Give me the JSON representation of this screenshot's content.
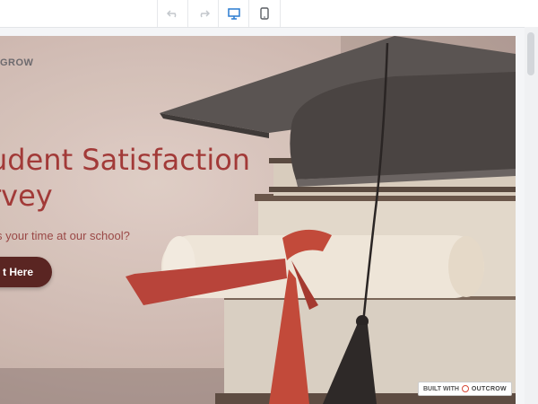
{
  "toolbar": {
    "undo_icon": "undo-icon",
    "redo_icon": "redo-icon",
    "desktop_icon": "desktop-icon",
    "mobile_icon": "mobile-icon",
    "active_color": "#2a7bd1"
  },
  "page": {
    "logo_text": "GROW",
    "title_line1": "udent Satisfaction",
    "title_line2": "rvey",
    "subtitle": "s your time at our school?",
    "cta_label": "t Here",
    "badge_prefix": "BUILT WITH",
    "badge_brand": "OUTCROW"
  },
  "colors": {
    "title": "#a23a38",
    "cta_bg": "#5a2522",
    "ribbon": "#c24a3a"
  }
}
